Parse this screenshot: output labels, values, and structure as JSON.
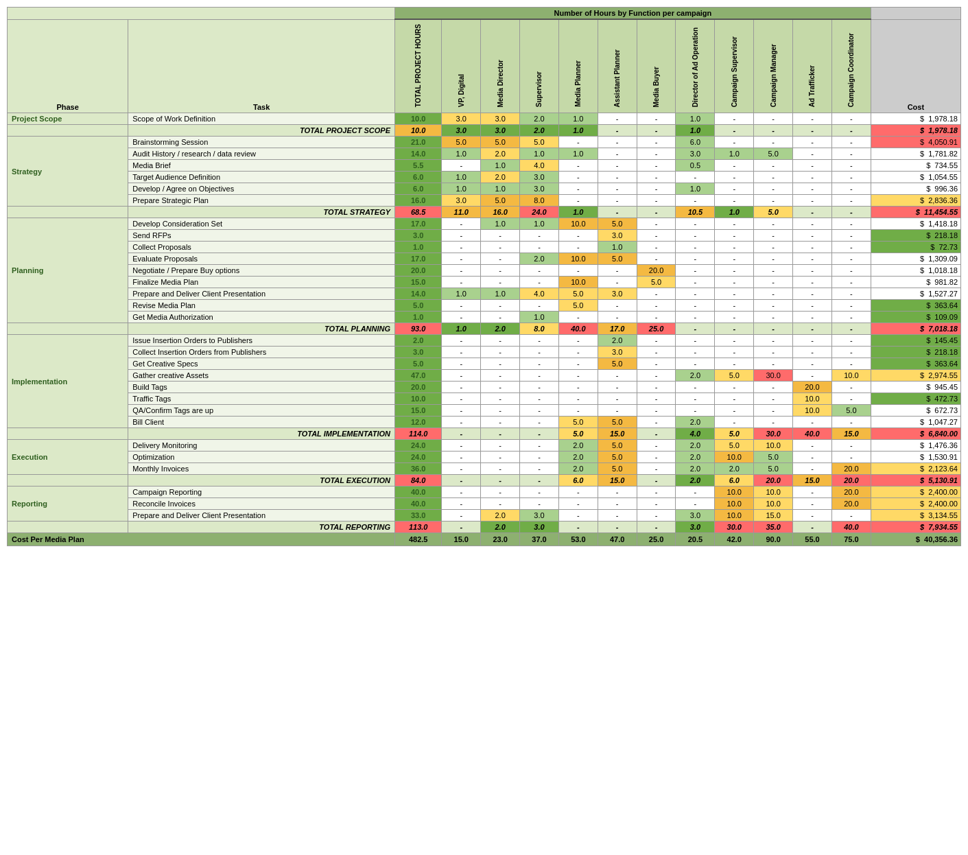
{
  "title": "Number of Hours by Function per campaign",
  "column_headers": {
    "phase": "Phase",
    "task": "Task",
    "total_hours": "TOTAL PROJECT HOURS",
    "vp_digital": "VP, Digital",
    "media_director": "Media Director",
    "supervisor": "Supervisor",
    "media_planner": "Media Planner",
    "asst_planner": "Assistant Planner",
    "media_buyer": "Media Buyer",
    "director_ad_ops": "Director of Ad Operation",
    "campaign_supervisor": "Campaign Supervisor",
    "campaign_manager": "Campaign Manager",
    "ad_trafficker": "Ad Trafficker",
    "campaign_coordinator": "Campaign Coordinator",
    "cost": "Cost"
  },
  "rows": [
    {
      "phase": "Project Scope",
      "task": "Scope of Work Definition",
      "total": "10.0",
      "vp": "3.0",
      "md": "3.0",
      "sup": "2.0",
      "mp": "1.0",
      "ap": "-",
      "mb": "-",
      "dao": "1.0",
      "cs": "-",
      "cm": "-",
      "at": "-",
      "cc": "-",
      "cost": "1,978.18",
      "type": "data"
    },
    {
      "phase": "",
      "task": "TOTAL PROJECT SCOPE",
      "total": "10.0",
      "vp": "3.0",
      "md": "3.0",
      "sup": "2.0",
      "mp": "1.0",
      "ap": "-",
      "mb": "-",
      "dao": "1.0",
      "cs": "-",
      "cm": "-",
      "at": "-",
      "cc": "-",
      "cost": "1,978.18",
      "type": "total"
    },
    {
      "phase": "Strategy",
      "task": "Brainstorming Session",
      "total": "21.0",
      "vp": "5.0",
      "md": "5.0",
      "sup": "5.0",
      "mp": "-",
      "ap": "-",
      "mb": "-",
      "dao": "6.0",
      "cs": "-",
      "cm": "-",
      "at": "-",
      "cc": "-",
      "cost": "4,050.91",
      "type": "data"
    },
    {
      "phase": "",
      "task": "Audit History / research / data review",
      "total": "14.0",
      "vp": "1.0",
      "md": "2.0",
      "sup": "1.0",
      "mp": "1.0",
      "ap": "-",
      "mb": "-",
      "dao": "3.0",
      "cs": "1.0",
      "cm": "5.0",
      "at": "-",
      "cc": "-",
      "cost": "1,781.82",
      "type": "data"
    },
    {
      "phase": "",
      "task": "Media Brief",
      "total": "5.5",
      "vp": "-",
      "md": "1.0",
      "sup": "4.0",
      "mp": "-",
      "ap": "-",
      "mb": "-",
      "dao": "0.5",
      "cs": "-",
      "cm": "-",
      "at": "-",
      "cc": "-",
      "cost": "734.55",
      "type": "data"
    },
    {
      "phase": "",
      "task": "Target Audience Definition",
      "total": "6.0",
      "vp": "1.0",
      "md": "2.0",
      "sup": "3.0",
      "mp": "-",
      "ap": "-",
      "mb": "-",
      "dao": "-",
      "cs": "-",
      "cm": "-",
      "at": "-",
      "cc": "-",
      "cost": "1,054.55",
      "type": "data"
    },
    {
      "phase": "",
      "task": "Develop / Agree on Objectives",
      "total": "6.0",
      "vp": "1.0",
      "md": "1.0",
      "sup": "3.0",
      "mp": "-",
      "ap": "-",
      "mb": "-",
      "dao": "1.0",
      "cs": "-",
      "cm": "-",
      "at": "-",
      "cc": "-",
      "cost": "996.36",
      "type": "data"
    },
    {
      "phase": "",
      "task": "Prepare Strategic Plan",
      "total": "16.0",
      "vp": "3.0",
      "md": "5.0",
      "sup": "8.0",
      "mp": "-",
      "ap": "-",
      "mb": "-",
      "dao": "-",
      "cs": "-",
      "cm": "-",
      "at": "-",
      "cc": "-",
      "cost": "2,836.36",
      "type": "data"
    },
    {
      "phase": "",
      "task": "TOTAL STRATEGY",
      "total": "68.5",
      "vp": "11.0",
      "md": "16.0",
      "sup": "24.0",
      "mp": "1.0",
      "ap": "-",
      "mb": "-",
      "dao": "10.5",
      "cs": "1.0",
      "cm": "5.0",
      "at": "-",
      "cc": "-",
      "cost": "11,454.55",
      "type": "total"
    },
    {
      "phase": "Planning",
      "task": "Develop Consideration Set",
      "total": "17.0",
      "vp": "-",
      "md": "1.0",
      "sup": "1.0",
      "mp": "10.0",
      "ap": "5.0",
      "mb": "-",
      "dao": "-",
      "cs": "-",
      "cm": "-",
      "at": "-",
      "cc": "-",
      "cost": "1,418.18",
      "type": "data"
    },
    {
      "phase": "",
      "task": "Send RFPs",
      "total": "3.0",
      "vp": "-",
      "md": "-",
      "sup": "-",
      "mp": "-",
      "ap": "3.0",
      "mb": "-",
      "dao": "-",
      "cs": "-",
      "cm": "-",
      "at": "-",
      "cc": "-",
      "cost": "218.18",
      "type": "data"
    },
    {
      "phase": "",
      "task": "Collect Proposals",
      "total": "1.0",
      "vp": "-",
      "md": "-",
      "sup": "-",
      "mp": "-",
      "ap": "1.0",
      "mb": "-",
      "dao": "-",
      "cs": "-",
      "cm": "-",
      "at": "-",
      "cc": "-",
      "cost": "72.73",
      "type": "data"
    },
    {
      "phase": "",
      "task": "Evaluate Proposals",
      "total": "17.0",
      "vp": "-",
      "md": "-",
      "sup": "2.0",
      "mp": "10.0",
      "ap": "5.0",
      "mb": "-",
      "dao": "-",
      "cs": "-",
      "cm": "-",
      "at": "-",
      "cc": "-",
      "cost": "1,309.09",
      "type": "data"
    },
    {
      "phase": "",
      "task": "Negotiate / Prepare Buy options",
      "total": "20.0",
      "vp": "-",
      "md": "-",
      "sup": "-",
      "mp": "-",
      "ap": "-",
      "mb": "20.0",
      "dao": "-",
      "cs": "-",
      "cm": "-",
      "at": "-",
      "cc": "-",
      "cost": "1,018.18",
      "type": "data"
    },
    {
      "phase": "",
      "task": "Finalize Media Plan",
      "total": "15.0",
      "vp": "-",
      "md": "-",
      "sup": "-",
      "mp": "10.0",
      "ap": "-",
      "mb": "5.0",
      "dao": "-",
      "cs": "-",
      "cm": "-",
      "at": "-",
      "cc": "-",
      "cost": "981.82",
      "type": "data"
    },
    {
      "phase": "",
      "task": "Prepare and Deliver Client Presentation",
      "total": "14.0",
      "vp": "1.0",
      "md": "1.0",
      "sup": "4.0",
      "mp": "5.0",
      "ap": "3.0",
      "mb": "-",
      "dao": "-",
      "cs": "-",
      "cm": "-",
      "at": "-",
      "cc": "-",
      "cost": "1,527.27",
      "type": "data"
    },
    {
      "phase": "",
      "task": "Revise Media Plan",
      "total": "5.0",
      "vp": "-",
      "md": "-",
      "sup": "-",
      "mp": "5.0",
      "ap": "-",
      "mb": "-",
      "dao": "-",
      "cs": "-",
      "cm": "-",
      "at": "-",
      "cc": "-",
      "cost": "363.64",
      "type": "data"
    },
    {
      "phase": "",
      "task": "Get Media Authorization",
      "total": "1.0",
      "vp": "-",
      "md": "-",
      "sup": "1.0",
      "mp": "-",
      "ap": "-",
      "mb": "-",
      "dao": "-",
      "cs": "-",
      "cm": "-",
      "at": "-",
      "cc": "-",
      "cost": "109.09",
      "type": "data"
    },
    {
      "phase": "",
      "task": "TOTAL PLANNING",
      "total": "93.0",
      "vp": "1.0",
      "md": "2.0",
      "sup": "8.0",
      "mp": "40.0",
      "ap": "17.0",
      "mb": "25.0",
      "dao": "-",
      "cs": "-",
      "cm": "-",
      "at": "-",
      "cc": "-",
      "cost": "7,018.18",
      "type": "total"
    },
    {
      "phase": "Implementation",
      "task": "Issue Insertion Orders to Publishers",
      "total": "2.0",
      "vp": "-",
      "md": "-",
      "sup": "-",
      "mp": "-",
      "ap": "2.0",
      "mb": "-",
      "dao": "-",
      "cs": "-",
      "cm": "-",
      "at": "-",
      "cc": "-",
      "cost": "145.45",
      "type": "data"
    },
    {
      "phase": "",
      "task": "Collect Insertion Orders from Publishers",
      "total": "3.0",
      "vp": "-",
      "md": "-",
      "sup": "-",
      "mp": "-",
      "ap": "3.0",
      "mb": "-",
      "dao": "-",
      "cs": "-",
      "cm": "-",
      "at": "-",
      "cc": "-",
      "cost": "218.18",
      "type": "data"
    },
    {
      "phase": "",
      "task": "Get Creative Specs",
      "total": "5.0",
      "vp": "-",
      "md": "-",
      "sup": "-",
      "mp": "-",
      "ap": "5.0",
      "mb": "-",
      "dao": "-",
      "cs": "-",
      "cm": "-",
      "at": "-",
      "cc": "-",
      "cost": "363.64",
      "type": "data"
    },
    {
      "phase": "",
      "task": "Gather creative Assets",
      "total": "47.0",
      "vp": "-",
      "md": "-",
      "sup": "-",
      "mp": "-",
      "ap": "-",
      "mb": "-",
      "dao": "2.0",
      "cs": "5.0",
      "cm": "30.0",
      "at": "-",
      "cc": "10.0",
      "cost": "2,974.55",
      "type": "data"
    },
    {
      "phase": "",
      "task": "Build Tags",
      "total": "20.0",
      "vp": "-",
      "md": "-",
      "sup": "-",
      "mp": "-",
      "ap": "-",
      "mb": "-",
      "dao": "-",
      "cs": "-",
      "cm": "-",
      "at": "20.0",
      "cc": "-",
      "cost": "945.45",
      "type": "data"
    },
    {
      "phase": "",
      "task": "Traffic Tags",
      "total": "10.0",
      "vp": "-",
      "md": "-",
      "sup": "-",
      "mp": "-",
      "ap": "-",
      "mb": "-",
      "dao": "-",
      "cs": "-",
      "cm": "-",
      "at": "10.0",
      "cc": "-",
      "cost": "472.73",
      "type": "data"
    },
    {
      "phase": "",
      "task": "QA/Confirm Tags are up",
      "total": "15.0",
      "vp": "-",
      "md": "-",
      "sup": "-",
      "mp": "-",
      "ap": "-",
      "mb": "-",
      "dao": "-",
      "cs": "-",
      "cm": "-",
      "at": "10.0",
      "cc": "5.0",
      "cost": "672.73",
      "type": "data"
    },
    {
      "phase": "",
      "task": "Bill Client",
      "total": "12.0",
      "vp": "-",
      "md": "-",
      "sup": "-",
      "mp": "5.0",
      "ap": "5.0",
      "mb": "-",
      "dao": "2.0",
      "cs": "-",
      "cm": "-",
      "at": "-",
      "cc": "-",
      "cost": "1,047.27",
      "type": "data"
    },
    {
      "phase": "",
      "task": "TOTAL IMPLEMENTATION",
      "total": "114.0",
      "vp": "-",
      "md": "-",
      "sup": "-",
      "mp": "5.0",
      "ap": "15.0",
      "mb": "-",
      "dao": "4.0",
      "cs": "5.0",
      "cm": "30.0",
      "at": "40.0",
      "cc": "15.0",
      "cost": "6,840.00",
      "type": "total"
    },
    {
      "phase": "Execution",
      "task": "Delivery Monitoring",
      "total": "24.0",
      "vp": "-",
      "md": "-",
      "sup": "-",
      "mp": "2.0",
      "ap": "5.0",
      "mb": "-",
      "dao": "2.0",
      "cs": "5.0",
      "cm": "10.0",
      "at": "-",
      "cc": "-",
      "cost": "1,476.36",
      "type": "data"
    },
    {
      "phase": "",
      "task": "Optimization",
      "total": "24.0",
      "vp": "-",
      "md": "-",
      "sup": "-",
      "mp": "2.0",
      "ap": "5.0",
      "mb": "-",
      "dao": "2.0",
      "cs": "10.0",
      "cm": "5.0",
      "at": "-",
      "cc": "-",
      "cost": "1,530.91",
      "type": "data"
    },
    {
      "phase": "",
      "task": "Monthly Invoices",
      "total": "36.0",
      "vp": "-",
      "md": "-",
      "sup": "-",
      "mp": "2.0",
      "ap": "5.0",
      "mb": "-",
      "dao": "2.0",
      "cs": "2.0",
      "cm": "5.0",
      "at": "-",
      "cc": "20.0",
      "cost": "2,123.64",
      "type": "data"
    },
    {
      "phase": "",
      "task": "TOTAL EXECUTION",
      "total": "84.0",
      "vp": "-",
      "md": "-",
      "sup": "-",
      "mp": "6.0",
      "ap": "15.0",
      "mb": "-",
      "dao": "2.0",
      "cs": "6.0",
      "cm": "20.0",
      "at": "15.0",
      "cc": "20.0",
      "cost": "5,130.91",
      "type": "total"
    },
    {
      "phase": "Reporting",
      "task": "Campaign Reporting",
      "total": "40.0",
      "vp": "-",
      "md": "-",
      "sup": "-",
      "mp": "-",
      "ap": "-",
      "mb": "-",
      "dao": "-",
      "cs": "10.0",
      "cm": "10.0",
      "at": "-",
      "cc": "20.0",
      "cost": "2,400.00",
      "type": "data"
    },
    {
      "phase": "",
      "task": "Reconcile Invoices",
      "total": "40.0",
      "vp": "-",
      "md": "-",
      "sup": "-",
      "mp": "-",
      "ap": "-",
      "mb": "-",
      "dao": "-",
      "cs": "10.0",
      "cm": "10.0",
      "at": "-",
      "cc": "20.0",
      "cost": "2,400.00",
      "type": "data"
    },
    {
      "phase": "",
      "task": "Prepare and Deliver Client Presentation",
      "total": "33.0",
      "vp": "-",
      "md": "2.0",
      "sup": "3.0",
      "mp": "-",
      "ap": "-",
      "mb": "-",
      "dao": "3.0",
      "cs": "10.0",
      "cm": "15.0",
      "at": "-",
      "cc": "-",
      "cost": "3,134.55",
      "type": "data"
    },
    {
      "phase": "",
      "task": "TOTAL REPORTING",
      "total": "113.0",
      "vp": "-",
      "md": "2.0",
      "sup": "3.0",
      "mp": "-",
      "ap": "-",
      "mb": "-",
      "dao": "3.0",
      "cs": "30.0",
      "cm": "35.0",
      "at": "-",
      "cc": "40.0",
      "cost": "7,934.55",
      "type": "total"
    },
    {
      "phase": "Cost Per Media Plan",
      "task": "",
      "total": "482.5",
      "vp": "15.0",
      "md": "23.0",
      "sup": "37.0",
      "mp": "53.0",
      "ap": "47.0",
      "mb": "25.0",
      "dao": "20.5",
      "cs": "42.0",
      "cm": "90.0",
      "at": "55.0",
      "cc": "75.0",
      "cost": "40,356.36",
      "type": "bottom"
    }
  ]
}
